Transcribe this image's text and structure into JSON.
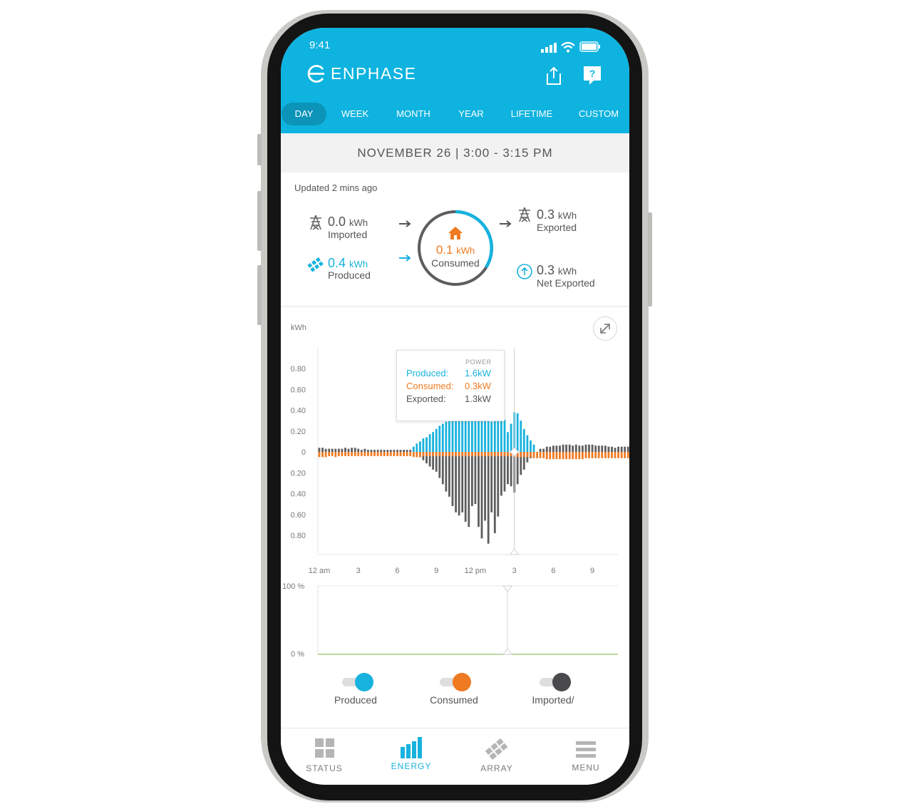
{
  "status": {
    "time": "9:41"
  },
  "brand": {
    "name": "ENPHASE"
  },
  "colors": {
    "accent": "#0eb3df",
    "produced": "#17b2de",
    "consumed": "#f07a22",
    "exported": "#5d5d5f"
  },
  "tabs": [
    {
      "label": "DAY",
      "active": true
    },
    {
      "label": "WEEK"
    },
    {
      "label": "MONTH"
    },
    {
      "label": "YEAR"
    },
    {
      "label": "LIFETIME"
    },
    {
      "label": "CUSTOM"
    }
  ],
  "date_range": "NOVEMBER 26 | 3:00 - 3:15 PM",
  "updated": "Updated 2 mins ago",
  "summary": {
    "imported": {
      "value": "0.0",
      "unit": "kWh",
      "label": "Imported"
    },
    "produced": {
      "value": "0.4",
      "unit": "kWh",
      "label": "Produced"
    },
    "consumed": {
      "value": "0.1",
      "unit": "kWh",
      "label": "Consumed"
    },
    "exported": {
      "value": "0.3",
      "unit": "kWh",
      "label": "Exported"
    },
    "net_exported": {
      "value": "0.3",
      "unit": "kWh",
      "label": "Net Exported"
    }
  },
  "chart": {
    "ylabel": "kWh"
  },
  "tooltip": {
    "header": "POWER",
    "rows": [
      {
        "label": "Produced:",
        "value": "1.6kW",
        "color": "#17b2de"
      },
      {
        "label": "Consumed:",
        "value": "0.3kW",
        "color": "#f07a22"
      },
      {
        "label": "Exported:",
        "value": "1.3kW",
        "color": "#555555"
      }
    ]
  },
  "chart_data": {
    "type": "bar",
    "ylabel": "kWh",
    "y_ticks": [
      "0.80",
      "0.60",
      "0.40",
      "0.20",
      "0",
      "0.20",
      "0.40",
      "0.60",
      "0.80"
    ],
    "x_ticks": [
      "12 am",
      "3",
      "6",
      "9",
      "12 pm",
      "3",
      "6",
      "9"
    ],
    "ylim": [
      -0.9,
      0.9
    ],
    "x_hours": [
      0,
      0.25,
      0.5,
      0.75,
      1,
      1.25,
      1.5,
      1.75,
      2,
      2.25,
      2.5,
      2.75,
      3,
      3.25,
      3.5,
      3.75,
      4,
      4.25,
      4.5,
      4.75,
      5,
      5.25,
      5.5,
      5.75,
      6,
      6.25,
      6.5,
      6.75,
      7,
      7.25,
      7.5,
      7.75,
      8,
      8.25,
      8.5,
      8.75,
      9,
      9.25,
      9.5,
      9.75,
      10,
      10.25,
      10.5,
      10.75,
      11,
      11.25,
      11.5,
      11.75,
      12,
      12.25,
      12.5,
      12.75,
      13,
      13.25,
      13.5,
      13.75,
      14,
      14.25,
      14.5,
      14.75,
      15,
      15.25,
      15.5,
      15.75,
      16,
      16.25,
      16.5,
      16.75,
      17,
      17.25,
      17.5,
      17.75,
      18,
      18.25,
      18.5,
      18.75,
      19,
      19.25,
      19.5,
      19.75,
      20,
      20.25,
      20.5,
      20.75,
      21,
      21.25,
      21.5,
      21.75,
      22,
      22.25,
      22.5,
      22.75,
      23,
      23.25,
      23.5,
      23.75
    ],
    "series": [
      {
        "name": "Produced",
        "color": "#17b2de",
        "values": [
          0,
          0,
          0,
          0,
          0,
          0,
          0,
          0,
          0,
          0,
          0,
          0,
          0,
          0,
          0,
          0,
          0,
          0,
          0,
          0,
          0,
          0,
          0,
          0,
          0,
          0,
          0,
          0,
          0,
          0.05,
          0.08,
          0.1,
          0.13,
          0.14,
          0.17,
          0.19,
          0.22,
          0.25,
          0.27,
          0.29,
          0.31,
          0.31,
          0.31,
          0.31,
          0.31,
          0.31,
          0.31,
          0.31,
          0.31,
          0.31,
          0.31,
          0.31,
          0.31,
          0.29,
          0.31,
          0.31,
          0.31,
          0.31,
          0.19,
          0.27,
          0.38,
          0.37,
          0.3,
          0.22,
          0.16,
          0.11,
          0.07,
          0,
          0,
          0,
          0,
          0,
          0,
          0,
          0,
          0,
          0,
          0,
          0,
          0,
          0,
          0,
          0,
          0,
          0,
          0,
          0,
          0,
          0,
          0,
          0,
          0,
          0,
          0,
          0,
          0
        ]
      },
      {
        "name": "Consumed",
        "color": "#f07a22",
        "values": [
          -0.05,
          -0.05,
          -0.05,
          -0.04,
          -0.04,
          -0.05,
          -0.04,
          -0.04,
          -0.04,
          -0.04,
          -0.04,
          -0.04,
          -0.04,
          -0.04,
          -0.04,
          -0.04,
          -0.04,
          -0.04,
          -0.04,
          -0.04,
          -0.04,
          -0.04,
          -0.04,
          -0.04,
          -0.04,
          -0.04,
          -0.04,
          -0.04,
          -0.04,
          -0.05,
          -0.05,
          -0.05,
          -0.04,
          -0.04,
          -0.04,
          -0.04,
          -0.04,
          -0.04,
          -0.04,
          -0.04,
          -0.04,
          -0.04,
          -0.04,
          -0.04,
          -0.04,
          -0.04,
          -0.04,
          -0.04,
          -0.04,
          -0.04,
          -0.04,
          -0.04,
          -0.04,
          -0.04,
          -0.04,
          -0.04,
          -0.04,
          -0.04,
          -0.04,
          -0.04,
          -0.05,
          -0.05,
          -0.05,
          -0.05,
          -0.05,
          -0.05,
          -0.06,
          -0.06,
          -0.06,
          -0.06,
          -0.07,
          -0.07,
          -0.07,
          -0.07,
          -0.07,
          -0.07,
          -0.07,
          -0.07,
          -0.07,
          -0.07,
          -0.07,
          -0.07,
          -0.06,
          -0.06,
          -0.06,
          -0.06,
          -0.06,
          -0.06,
          -0.06,
          -0.06,
          -0.06,
          -0.06,
          -0.06,
          -0.06,
          -0.06,
          -0.06
        ]
      },
      {
        "name": "Imported/Exported",
        "color": "#5d5d5f",
        "values": [
          0.04,
          0.04,
          0.03,
          0.03,
          0.03,
          0.03,
          0.03,
          0.03,
          0.04,
          0.03,
          0.04,
          0.04,
          0.03,
          0.02,
          0.03,
          0.02,
          0.02,
          0.02,
          0.02,
          0.02,
          0.02,
          0.02,
          0.02,
          0.02,
          0.02,
          0.02,
          0.02,
          0.02,
          0.02,
          0,
          -0.02,
          -0.05,
          -0.08,
          -0.11,
          -0.14,
          -0.17,
          -0.19,
          -0.25,
          -0.31,
          -0.38,
          -0.43,
          -0.52,
          -0.58,
          -0.61,
          -0.58,
          -0.67,
          -0.72,
          -0.52,
          -0.5,
          -0.72,
          -0.83,
          -0.66,
          -0.88,
          -0.58,
          -0.78,
          -0.62,
          -0.42,
          -0.38,
          -0.31,
          -0.33,
          -0.39,
          -0.31,
          -0.22,
          -0.17,
          -0.1,
          -0.06,
          -0.03,
          0,
          0.03,
          0.03,
          0.05,
          0.05,
          0.06,
          0.06,
          0.06,
          0.07,
          0.07,
          0.07,
          0.06,
          0.07,
          0.06,
          0.06,
          0.07,
          0.07,
          0.07,
          0.06,
          0.06,
          0.06,
          0.06,
          0.05,
          0.05,
          0.04,
          0.05,
          0.05,
          0.05,
          0.05
        ]
      }
    ]
  },
  "soc_chart": {
    "top_label": "100 %",
    "bottom_label": "0 %"
  },
  "legend": [
    {
      "label": "Produced",
      "color": "#17b2de"
    },
    {
      "label": "Consumed",
      "color": "#f07a22"
    },
    {
      "label": "Imported/",
      "color": "#4a4a4c"
    }
  ],
  "nav": [
    {
      "label": "STATUS",
      "active": false
    },
    {
      "label": "ENERGY",
      "active": true
    },
    {
      "label": "ARRAY",
      "active": false
    },
    {
      "label": "MENU",
      "active": false
    }
  ]
}
